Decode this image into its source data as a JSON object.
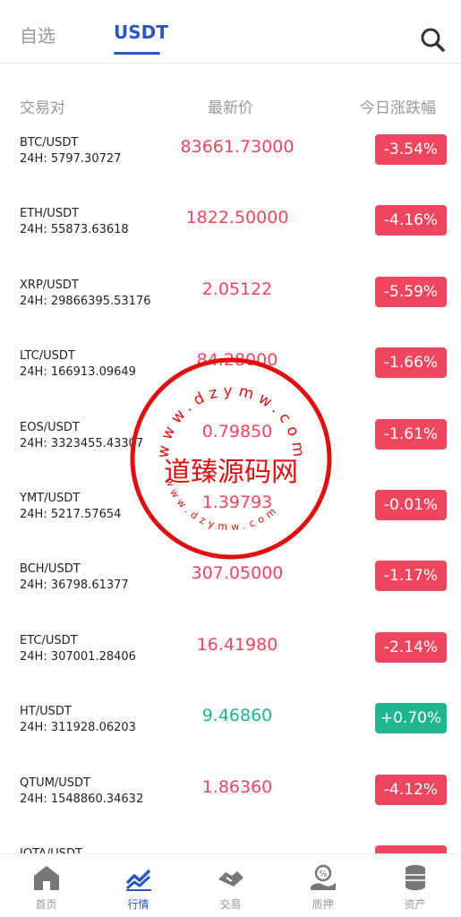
{
  "tabs": {
    "favorites": "自选",
    "usdt": "USDT"
  },
  "columns": {
    "pair": "交易对",
    "price": "最新价",
    "change": "今日涨跌幅"
  },
  "rows": [
    {
      "pair": "BTC/USDT",
      "vol": "24H: 5797.30727",
      "price": "83661.73000",
      "change": "-3.54%",
      "dir": "down"
    },
    {
      "pair": "ETH/USDT",
      "vol": "24H: 55873.63618",
      "price": "1822.50000",
      "change": "-4.16%",
      "dir": "down"
    },
    {
      "pair": "XRP/USDT",
      "vol": "24H: 29866395.53176",
      "price": "2.05122",
      "change": "-5.59%",
      "dir": "down"
    },
    {
      "pair": "LTC/USDT",
      "vol": "24H: 166913.09649",
      "price": "84.28000",
      "change": "-1.66%",
      "dir": "down"
    },
    {
      "pair": "EOS/USDT",
      "vol": "24H: 3323455.43307",
      "price": "0.79850",
      "change": "-1.61%",
      "dir": "down"
    },
    {
      "pair": "YMT/USDT",
      "vol": "24H: 5217.57654",
      "price": "1.39793",
      "change": "-0.01%",
      "dir": "down"
    },
    {
      "pair": "BCH/USDT",
      "vol": "24H: 36798.61377",
      "price": "307.05000",
      "change": "-1.17%",
      "dir": "down"
    },
    {
      "pair": "ETC/USDT",
      "vol": "24H: 307001.28406",
      "price": "16.41980",
      "change": "-2.14%",
      "dir": "down"
    },
    {
      "pair": "HT/USDT",
      "vol": "24H: 311928.06203",
      "price": "9.46860",
      "change": "+0.70%",
      "dir": "up"
    },
    {
      "pair": "QTUM/USDT",
      "vol": "24H: 1548860.34632",
      "price": "1.86360",
      "change": "-4.12%",
      "dir": "down"
    },
    {
      "pair": "IOTA/USDT",
      "vol": "",
      "price": "",
      "change": "",
      "dir": "down"
    }
  ],
  "watermark": {
    "text": "道臻源码网",
    "url": "www.dzymw.com"
  },
  "nav": [
    {
      "label": "首页",
      "icon": "home-icon"
    },
    {
      "label": "行情",
      "icon": "market-chart-icon"
    },
    {
      "label": "交易",
      "icon": "trade-handshake-icon"
    },
    {
      "label": "质押",
      "icon": "pledge-icon"
    },
    {
      "label": "资产",
      "icon": "assets-coins-icon"
    }
  ],
  "colors": {
    "accent": "#2b57c4",
    "down": "#f0455e",
    "up": "#1fb58f"
  }
}
